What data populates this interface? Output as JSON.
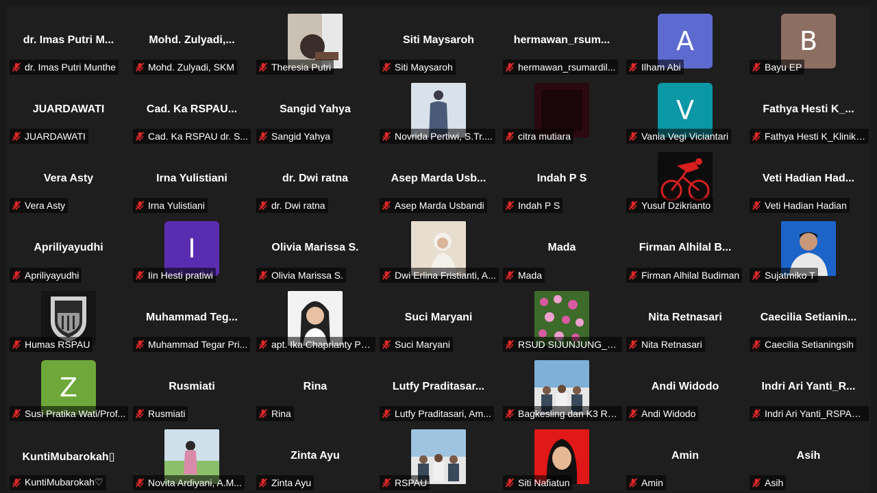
{
  "mute_color": "#e02828",
  "participants": [
    {
      "name": "dr. Imas Putri Munthe",
      "tile": "dr. Imas Putri M...",
      "kind": "name"
    },
    {
      "name": "Mohd. Zulyadi, SKM",
      "tile": "Mohd.  Zulyadi,...",
      "kind": "name"
    },
    {
      "name": "Theresia Putri",
      "kind": "photo",
      "photo": "person-selfie",
      "colors": [
        "#c9c2b4",
        "#3b2e2a"
      ]
    },
    {
      "name": "Siti Maysaroh",
      "tile": "Siti Maysaroh",
      "kind": "name"
    },
    {
      "name": "hermawan_rsumardil...",
      "tile": "hermawan_rsum...",
      "kind": "name"
    },
    {
      "name": "Ilham Abi",
      "kind": "avatar",
      "letter": "A",
      "color": "#5d6bd0"
    },
    {
      "name": "Bayu EP",
      "kind": "avatar",
      "letter": "B",
      "color": "#8d6e63"
    },
    {
      "name": "JUARDAWATI",
      "tile": "JUARDAWATI",
      "kind": "name"
    },
    {
      "name": "Cad. Ka RSPAU dr. S...",
      "tile": "Cad. Ka RSPAU...",
      "kind": "name"
    },
    {
      "name": "Sangid Yahya",
      "tile": "Sangid Yahya",
      "kind": "name"
    },
    {
      "name": "Novrida Pertiwi, S.Tr....",
      "kind": "photo",
      "photo": "person-standing",
      "colors": [
        "#d9e2ea",
        "#4a5a78"
      ]
    },
    {
      "name": "citra mutiara",
      "kind": "photo",
      "photo": "dark",
      "colors": [
        "#2a0a10",
        "#1a0508"
      ]
    },
    {
      "name": "Vania Vegi Viciantari",
      "kind": "avatar",
      "letter": "V",
      "color": "#0a97a6"
    },
    {
      "name": "Fathya Hesti K_Klinik ...",
      "tile": "Fathya Hesti K_...",
      "kind": "name"
    },
    {
      "name": "Vera Asty",
      "tile": "Vera Asty",
      "kind": "name"
    },
    {
      "name": "Irna Yulistiani",
      "tile": "Irna Yulistiani",
      "kind": "name"
    },
    {
      "name": "dr. Dwi ratna",
      "tile": "dr. Dwi ratna",
      "kind": "name"
    },
    {
      "name": "Asep Marda Usbandi",
      "tile": "Asep Marda Usb...",
      "kind": "name"
    },
    {
      "name": "Indah P S",
      "tile": "Indah P S",
      "kind": "name"
    },
    {
      "name": "Yusuf Dzikrianto",
      "kind": "photo",
      "photo": "cyclist",
      "colors": [
        "#0c0c0c",
        "#d81e1e"
      ]
    },
    {
      "name": "Veti Hadian Hadian",
      "tile": "Veti  Hadian  Had...",
      "kind": "name"
    },
    {
      "name": "Apriliyayudhi",
      "tile": "Apriliyayudhi",
      "kind": "name"
    },
    {
      "name": "Iin Hesti pratiwi",
      "kind": "avatar",
      "letter": "I",
      "color": "#5a2db0"
    },
    {
      "name": "Olivia Marissa S.",
      "tile": "Olivia Marissa S.",
      "kind": "name"
    },
    {
      "name": "Dwi Erlina Fristianti, A...",
      "kind": "photo",
      "photo": "person-hijab",
      "colors": [
        "#e8ded0",
        "#f4f0ea"
      ]
    },
    {
      "name": "Mada",
      "tile": "Mada",
      "kind": "name"
    },
    {
      "name": "Firman Alhilal Budiman",
      "tile": "Firman Alhilal B...",
      "kind": "name"
    },
    {
      "name": "Sujatmiko T",
      "kind": "photo",
      "photo": "person-uniform",
      "colors": [
        "#1c64c8",
        "#e8e8e8"
      ]
    },
    {
      "name": "Humas RSPAU",
      "kind": "photo",
      "photo": "humas-logo",
      "colors": [
        "#151515",
        "#cfcfcf"
      ]
    },
    {
      "name": "Muhammad Tegar Pri...",
      "tile": "Muhammad  Teg...",
      "kind": "name"
    },
    {
      "name": "apt. Ika Chaprianty Pa...",
      "kind": "photo",
      "photo": "person-smile",
      "colors": [
        "#f2f2f2",
        "#222222"
      ]
    },
    {
      "name": "Suci Maryani",
      "tile": "Suci Maryani",
      "kind": "name"
    },
    {
      "name": "RSUD SIJUNJUNG_YU...",
      "kind": "photo",
      "photo": "flowers",
      "colors": [
        "#3d6b2a",
        "#d85aa0"
      ]
    },
    {
      "name": "Nita Retnasari",
      "tile": "Nita Retnasari",
      "kind": "name"
    },
    {
      "name": "Caecilia Setianingsih",
      "tile": "Caecilia  Setianin...",
      "kind": "name"
    },
    {
      "name": "Susi Pratika Wati/Prof...",
      "kind": "avatar",
      "letter": "Z",
      "color": "#6ea83a"
    },
    {
      "name": "Rusmiati",
      "tile": "Rusmiati",
      "kind": "name"
    },
    {
      "name": "Rina",
      "tile": "Rina",
      "kind": "name"
    },
    {
      "name": "Lutfy Praditasari, Am...",
      "tile": "Lutfy  Praditasar...",
      "kind": "name"
    },
    {
      "name": "Bagkesling dan K3 RS...",
      "kind": "photo",
      "photo": "group",
      "colors": [
        "#7fb0d8",
        "#3a4a5a"
      ]
    },
    {
      "name": "Andi Widodo",
      "tile": "Andi Widodo",
      "kind": "name"
    },
    {
      "name": "Indri Ari Yanti_RSPAU ...",
      "tile": "Indri  Ari  Yanti_R...",
      "kind": "name"
    },
    {
      "name": "KuntiMubarokah♡",
      "tile": "KuntiMubarokah▯",
      "kind": "name"
    },
    {
      "name": "Novita Ardiyani, A.M...",
      "kind": "photo",
      "photo": "person-outdoor",
      "colors": [
        "#8cbf6a",
        "#d98aa8"
      ]
    },
    {
      "name": "Zinta Ayu",
      "tile": "Zinta Ayu",
      "kind": "name"
    },
    {
      "name": "RSPAU",
      "kind": "photo",
      "photo": "group",
      "colors": [
        "#9ec4e0",
        "#3a4a5a"
      ]
    },
    {
      "name": "Siti Nafiatun",
      "kind": "photo",
      "photo": "person-red",
      "colors": [
        "#e01818",
        "#111111"
      ]
    },
    {
      "name": "Amin",
      "tile": "Amin",
      "kind": "name"
    },
    {
      "name": "Asih",
      "tile": "Asih",
      "kind": "name"
    }
  ]
}
